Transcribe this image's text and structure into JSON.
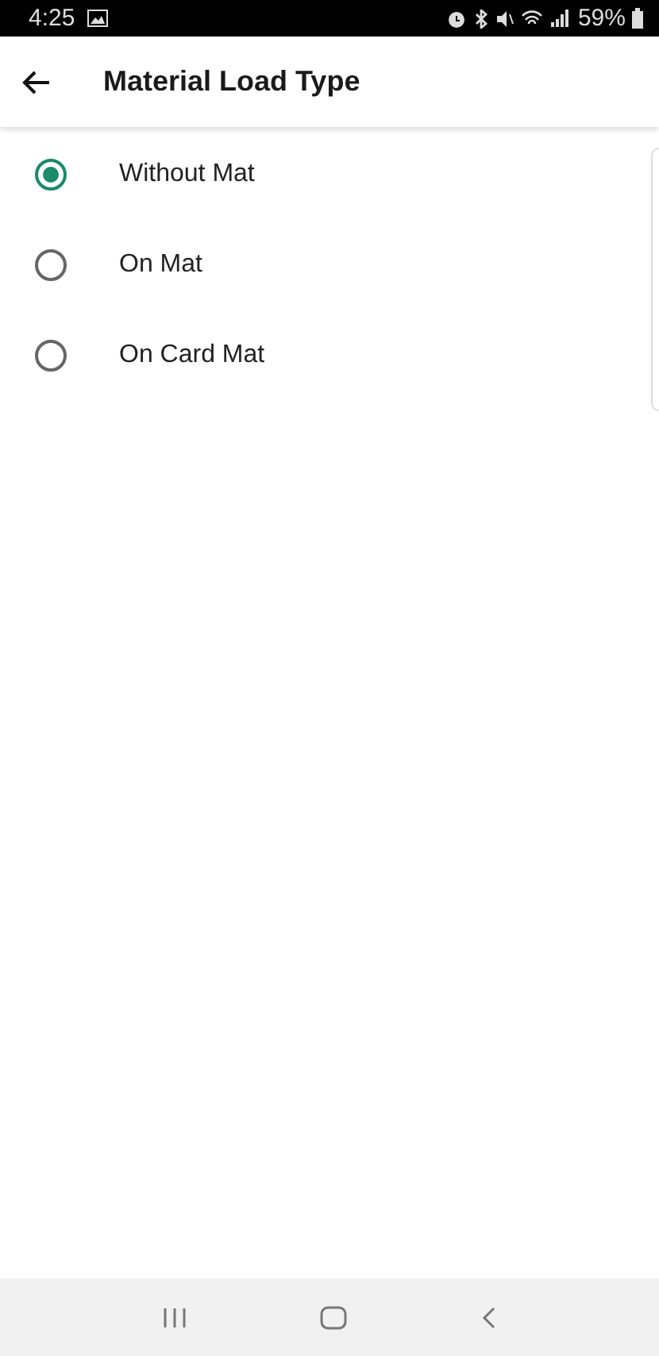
{
  "status_bar": {
    "time": "4:25",
    "battery": "59%"
  },
  "app_bar": {
    "title": "Material Load Type"
  },
  "options": [
    {
      "label": "Without Mat",
      "selected": true
    },
    {
      "label": "On Mat",
      "selected": false
    },
    {
      "label": "On Card Mat",
      "selected": false
    }
  ]
}
